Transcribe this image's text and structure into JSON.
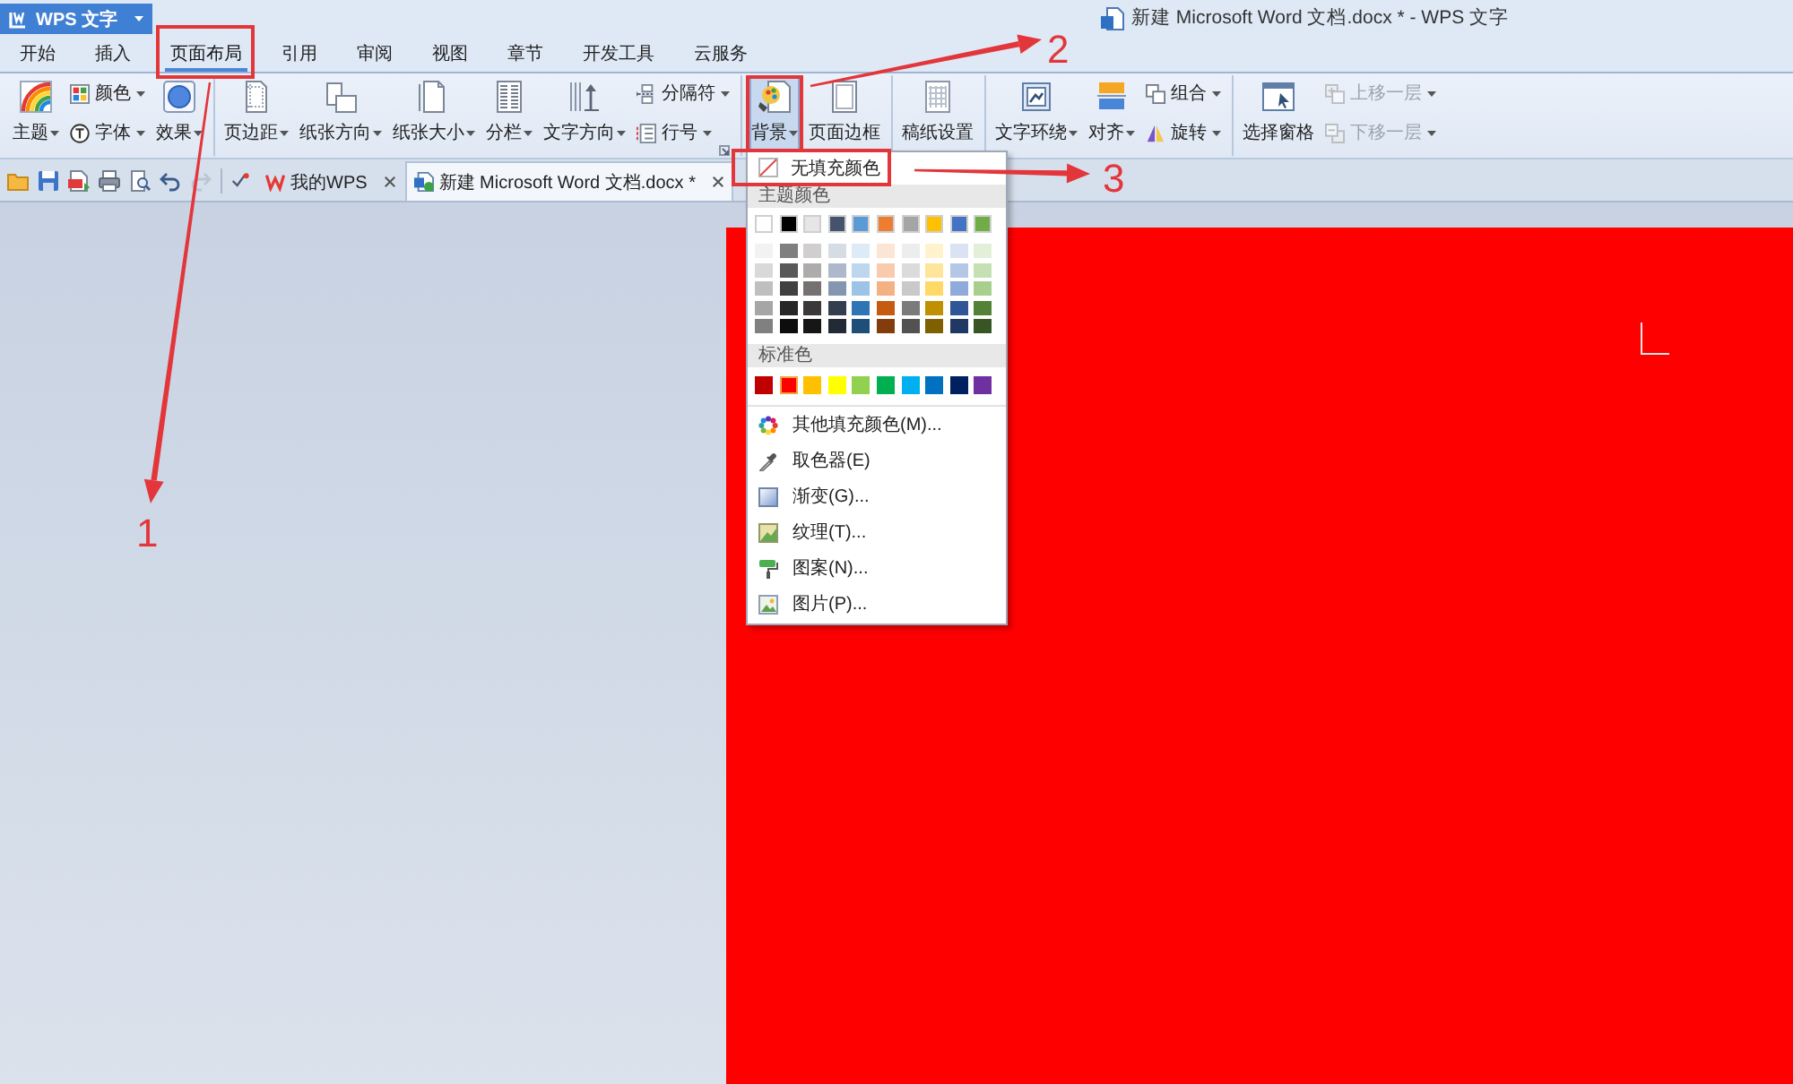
{
  "app_menu": {
    "label": "WPS 文字"
  },
  "window": {
    "title": "新建 Microsoft Word 文档.docx * - WPS 文字"
  },
  "tabs": [
    {
      "label": "开始",
      "selected": false,
      "highlighted": false
    },
    {
      "label": "插入",
      "selected": false,
      "highlighted": false
    },
    {
      "label": "页面布局",
      "selected": true,
      "highlighted": true
    },
    {
      "label": "引用",
      "selected": false,
      "highlighted": false
    },
    {
      "label": "审阅",
      "selected": false,
      "highlighted": false
    },
    {
      "label": "视图",
      "selected": false,
      "highlighted": false
    },
    {
      "label": "章节",
      "selected": false,
      "highlighted": false
    },
    {
      "label": "开发工具",
      "selected": false,
      "highlighted": false
    },
    {
      "label": "云服务",
      "selected": false,
      "highlighted": false
    }
  ],
  "ribbon": {
    "groups": [
      {
        "columns": [
          {
            "kind": "large",
            "label": "主题",
            "dropdown": true,
            "disabled": false,
            "pressed": false,
            "highlighted": false
          },
          {
            "kind": "stack",
            "items": [
              {
                "label": "颜色",
                "dropdown": true,
                "disabled": false,
                "pressed": false,
                "highlighted": false
              },
              {
                "label": "字体",
                "dropdown": true,
                "disabled": false,
                "pressed": false,
                "highlighted": false
              }
            ]
          },
          {
            "kind": "large",
            "label": "效果",
            "dropdown": true,
            "disabled": false,
            "pressed": false,
            "highlighted": false
          }
        ]
      },
      {
        "columns": [
          {
            "kind": "large",
            "label": "页边距",
            "dropdown": true,
            "disabled": false,
            "pressed": false,
            "highlighted": false
          },
          {
            "kind": "large",
            "label": "纸张方向",
            "dropdown": true,
            "disabled": false,
            "pressed": false,
            "highlighted": false
          },
          {
            "kind": "large",
            "label": "纸张大小",
            "dropdown": true,
            "disabled": false,
            "pressed": false,
            "highlighted": false
          },
          {
            "kind": "large",
            "label": "分栏",
            "dropdown": true,
            "disabled": false,
            "pressed": false,
            "highlighted": false
          },
          {
            "kind": "large",
            "label": "文字方向",
            "dropdown": true,
            "disabled": false,
            "pressed": false,
            "highlighted": false
          },
          {
            "kind": "stack",
            "items": [
              {
                "label": "分隔符",
                "dropdown": true,
                "disabled": false,
                "pressed": false,
                "highlighted": false
              },
              {
                "label": "行号",
                "dropdown": true,
                "disabled": false,
                "pressed": false,
                "highlighted": false
              }
            ]
          }
        ]
      },
      {
        "columns": [
          {
            "kind": "large",
            "label": "背景",
            "dropdown": true,
            "disabled": false,
            "pressed": true,
            "highlighted": true
          },
          {
            "kind": "large",
            "label": "页面边框",
            "dropdown": false,
            "disabled": false,
            "pressed": false,
            "highlighted": false
          }
        ]
      },
      {
        "columns": [
          {
            "kind": "large",
            "label": "稿纸设置",
            "dropdown": false,
            "disabled": false,
            "pressed": false,
            "highlighted": false
          }
        ]
      },
      {
        "columns": [
          {
            "kind": "large",
            "label": "文字环绕",
            "dropdown": true,
            "disabled": false,
            "pressed": false,
            "highlighted": false
          },
          {
            "kind": "large",
            "label": "对齐",
            "dropdown": true,
            "disabled": false,
            "pressed": false,
            "highlighted": false
          },
          {
            "kind": "stack",
            "items": [
              {
                "label": "组合",
                "dropdown": true,
                "disabled": false,
                "pressed": false,
                "highlighted": false
              },
              {
                "label": "旋转",
                "dropdown": true,
                "disabled": false,
                "pressed": false,
                "highlighted": false
              }
            ]
          }
        ]
      },
      {
        "columns": [
          {
            "kind": "large",
            "label": "选择窗格",
            "dropdown": false,
            "disabled": false,
            "pressed": false,
            "highlighted": false
          },
          {
            "kind": "stack",
            "items": [
              {
                "label": "上移一层",
                "dropdown": true,
                "disabled": true,
                "pressed": false,
                "highlighted": false
              },
              {
                "label": "下移一层",
                "dropdown": true,
                "disabled": true,
                "pressed": false,
                "highlighted": false
              }
            ]
          }
        ]
      }
    ]
  },
  "quick_access": [
    {
      "disabled": false
    },
    {
      "disabled": false
    },
    {
      "disabled": false
    },
    {
      "disabled": false
    },
    {
      "disabled": false
    },
    {
      "disabled": false
    },
    {
      "disabled": true
    }
  ],
  "document_tabs": [
    {
      "label": "我的WPS",
      "selected": false
    },
    {
      "label": "新建 Microsoft Word 文档.docx *",
      "selected": true
    }
  ],
  "background_menu": {
    "no_fill": {
      "label": "无填充颜色",
      "highlighted": true
    },
    "theme_colors": {
      "header": "主题颜色",
      "base": [
        {
          "color": "#ffffff",
          "selected": false
        },
        {
          "color": "#000000",
          "selected": false
        },
        {
          "color": "#e7e6e6",
          "selected": false
        },
        {
          "color": "#44546a",
          "selected": false
        },
        {
          "color": "#5b9bd5",
          "selected": false
        },
        {
          "color": "#ed7d31",
          "selected": false
        },
        {
          "color": "#a5a5a5",
          "selected": false
        },
        {
          "color": "#ffc000",
          "selected": false
        },
        {
          "color": "#4472c4",
          "selected": false
        },
        {
          "color": "#70ad47",
          "selected": false
        }
      ],
      "shades": [
        [
          {
            "color": "#f2f2f2",
            "selected": false
          },
          {
            "color": "#7f7f7f",
            "selected": false
          },
          {
            "color": "#d0cece",
            "selected": false
          },
          {
            "color": "#d6dce4",
            "selected": false
          },
          {
            "color": "#deebf6",
            "selected": false
          },
          {
            "color": "#fbe5d5",
            "selected": false
          },
          {
            "color": "#ededed",
            "selected": false
          },
          {
            "color": "#fff2cc",
            "selected": false
          },
          {
            "color": "#dae3f3",
            "selected": false
          },
          {
            "color": "#e2efd9",
            "selected": false
          }
        ],
        [
          {
            "color": "#d9d9d9",
            "selected": false
          },
          {
            "color": "#595959",
            "selected": false
          },
          {
            "color": "#aeabab",
            "selected": false
          },
          {
            "color": "#adb9ca",
            "selected": false
          },
          {
            "color": "#bdd7ee",
            "selected": false
          },
          {
            "color": "#f8cbad",
            "selected": false
          },
          {
            "color": "#dbdbdb",
            "selected": false
          },
          {
            "color": "#fee599",
            "selected": false
          },
          {
            "color": "#b4c7e7",
            "selected": false
          },
          {
            "color": "#c5e0b3",
            "selected": false
          }
        ],
        [
          {
            "color": "#bfbfbf",
            "selected": false
          },
          {
            "color": "#404040",
            "selected": false
          },
          {
            "color": "#757171",
            "selected": false
          },
          {
            "color": "#8496b0",
            "selected": false
          },
          {
            "color": "#9dc3e6",
            "selected": false
          },
          {
            "color": "#f4b183",
            "selected": false
          },
          {
            "color": "#c9c9c9",
            "selected": false
          },
          {
            "color": "#ffd965",
            "selected": false
          },
          {
            "color": "#8faadc",
            "selected": false
          },
          {
            "color": "#a8d08d",
            "selected": false
          }
        ],
        [
          {
            "color": "#a6a6a6",
            "selected": false
          },
          {
            "color": "#262626",
            "selected": false
          },
          {
            "color": "#3a3838",
            "selected": false
          },
          {
            "color": "#333f4f",
            "selected": false
          },
          {
            "color": "#2e75b5",
            "selected": false
          },
          {
            "color": "#c55a11",
            "selected": false
          },
          {
            "color": "#7b7b7b",
            "selected": false
          },
          {
            "color": "#bf9000",
            "selected": false
          },
          {
            "color": "#2f5597",
            "selected": false
          },
          {
            "color": "#538135",
            "selected": false
          }
        ],
        [
          {
            "color": "#808080",
            "selected": false
          },
          {
            "color": "#0d0d0d",
            "selected": false
          },
          {
            "color": "#171616",
            "selected": false
          },
          {
            "color": "#222a35",
            "selected": false
          },
          {
            "color": "#1f4e79",
            "selected": false
          },
          {
            "color": "#833c0b",
            "selected": false
          },
          {
            "color": "#525252",
            "selected": false
          },
          {
            "color": "#7f6000",
            "selected": false
          },
          {
            "color": "#203864",
            "selected": false
          },
          {
            "color": "#375623",
            "selected": false
          }
        ]
      ]
    },
    "standard_colors": {
      "header": "标准色",
      "swatches": [
        {
          "color": "#c00000",
          "selected": false
        },
        {
          "color": "#ff0000",
          "selected": true
        },
        {
          "color": "#ffc000",
          "selected": false
        },
        {
          "color": "#ffff00",
          "selected": false
        },
        {
          "color": "#92d050",
          "selected": false
        },
        {
          "color": "#00b050",
          "selected": false
        },
        {
          "color": "#00b0f0",
          "selected": false
        },
        {
          "color": "#0070c0",
          "selected": false
        },
        {
          "color": "#002060",
          "selected": false
        },
        {
          "color": "#7030a0",
          "selected": false
        }
      ]
    },
    "commands": [
      {
        "label": "其他填充颜色(M)..."
      },
      {
        "label": "取色器(E)"
      },
      {
        "label": "渐变(G)..."
      },
      {
        "label": "纹理(T)..."
      },
      {
        "label": "图案(N)..."
      },
      {
        "label": "图片(P)..."
      }
    ]
  },
  "annotations": [
    {
      "number": "1"
    },
    {
      "number": "2"
    },
    {
      "number": "3"
    }
  ]
}
